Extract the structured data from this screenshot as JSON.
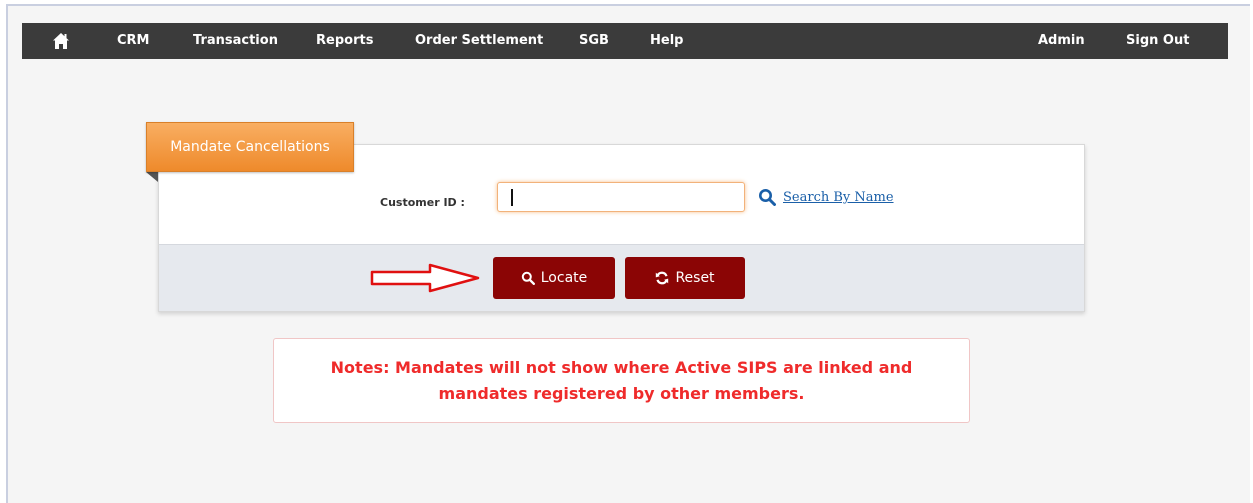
{
  "navbar": {
    "items": [
      "CRM",
      "Transaction",
      "Reports",
      "Order Settlement",
      "SGB",
      "Help"
    ],
    "right_items": [
      "Admin",
      "Sign Out"
    ]
  },
  "form": {
    "tab_title": "Mandate Cancellations",
    "customer_id_label": "Customer ID :",
    "customer_id_value": "",
    "search_link": "Search By Name"
  },
  "buttons": {
    "locate": "Locate",
    "reset": "Reset"
  },
  "notes": "Notes: Mandates will not show where Active SIPS are linked and mandates registered by other members.",
  "colors": {
    "navbar_bg": "#3b3b3b",
    "tab_orange": "#ee8a2b",
    "button_maroon": "#8b0505",
    "note_red": "#ef2b2b",
    "link_blue": "#1a5fa8",
    "arrow_red": "#e01010"
  },
  "icons": {
    "home": "home-icon",
    "search": "search-icon",
    "locate": "search-icon",
    "reset": "refresh-icon",
    "pointer": "arrow-right-icon"
  }
}
